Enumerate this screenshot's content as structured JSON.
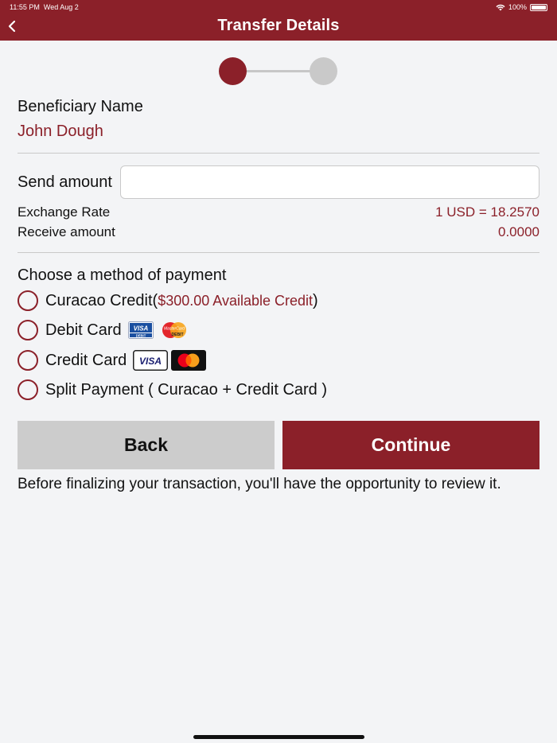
{
  "status_bar": {
    "time": "11:55 PM",
    "date": "Wed Aug 2",
    "battery": "100%"
  },
  "header": {
    "title": "Transfer Details",
    "back_icon": "chevron-left-icon"
  },
  "stepper": {
    "steps": 2,
    "current": 1
  },
  "beneficiary": {
    "label": "Beneficiary Name",
    "name": "John Dough"
  },
  "send": {
    "label": "Send amount",
    "value": "",
    "placeholder": ""
  },
  "exchange": {
    "label": "Exchange Rate",
    "value": "1 USD = 18.2570"
  },
  "receive": {
    "label": "Receive amount",
    "value": "0.0000"
  },
  "payment": {
    "heading": "Choose a method of payment",
    "options": [
      {
        "label": "Curacao Credit",
        "extra_open": " (",
        "extra": "$300.00 Available Credit",
        "extra_close": ")"
      },
      {
        "label": "Debit Card"
      },
      {
        "label": "Credit Card"
      },
      {
        "label": "Split Payment ( Curacao + Credit Card )"
      }
    ],
    "card_icons": {
      "visa_debit": "VISA",
      "visa_debit_sub": "DEBIT",
      "mc_debit": "MasterCard",
      "mc_debit_sub": "DEBIT",
      "visa": "VISA"
    }
  },
  "buttons": {
    "back": "Back",
    "continue": "Continue"
  },
  "note": "Before finalizing your transaction, you'll have the opportunity to review it.",
  "colors": {
    "brand": "#8b2029",
    "background": "#f3f4f6",
    "button_gray": "#cccccc"
  }
}
